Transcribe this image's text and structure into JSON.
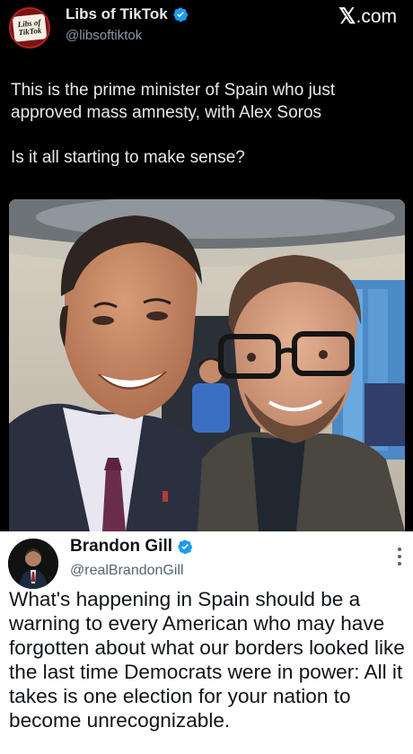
{
  "post": {
    "author_name": "Libs of TikTok",
    "author_handle": "@libsoftiktok",
    "avatar_text_line1": "Libs of",
    "avatar_text_line2": "TikTok",
    "brand_mark": "𝕏",
    "brand_suffix": ".com",
    "text_paragraph_1": "This is the prime minister of Spain who just approved mass amnesty, with Alex Soros",
    "text_paragraph_2": "Is it all starting to make sense?",
    "image_icon": "photo-of-two-men-selfie"
  },
  "quoted_post": {
    "author_name": "Brandon Gill",
    "author_handle": "@realBrandonGill",
    "text": "What's happening in Spain should be a warning to every American who may have forgotten about what our borders looked like the last time Democrats were in power: All it takes is one election for your nation to become unrecognizable.",
    "more_icon": "more-vertical-icon"
  },
  "colors": {
    "background": "#000000",
    "verified_badge": "#1d9bf0",
    "secondary_text": "#8b98a5",
    "quote_background": "#ffffff"
  }
}
